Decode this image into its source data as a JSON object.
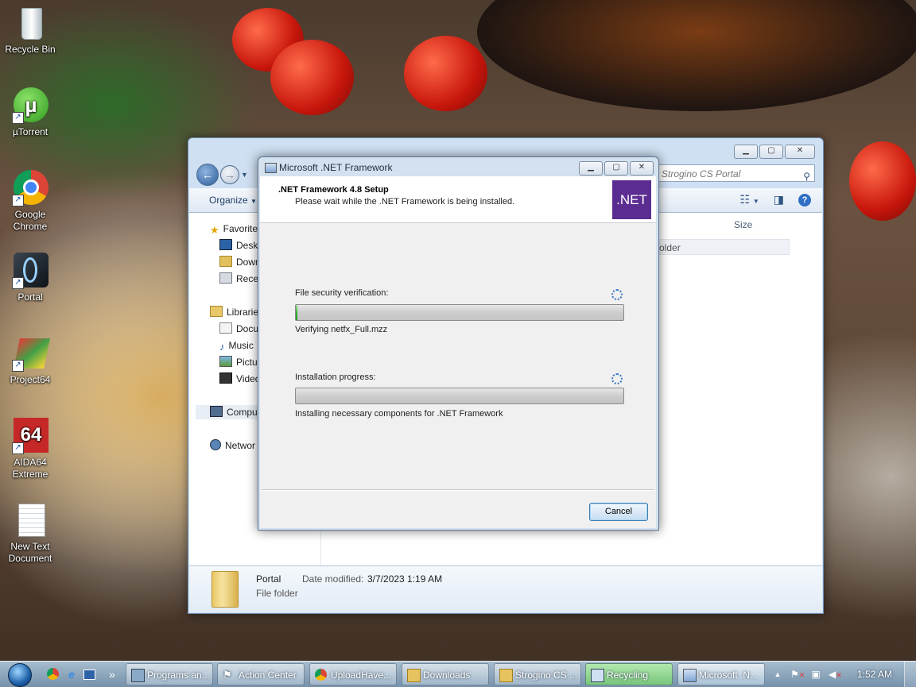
{
  "desktop": {
    "icons": [
      {
        "label": "Recycle Bin"
      },
      {
        "label": "µTorrent"
      },
      {
        "label": "Google Chrome"
      },
      {
        "label": "Portal"
      },
      {
        "label": "Project64"
      },
      {
        "label": "AIDA64 Extreme"
      },
      {
        "label": "New Text Document"
      }
    ]
  },
  "explorer": {
    "search_placeholder": "Strogino CS Portal",
    "organize_label": "Organize",
    "nav": [
      {
        "label": "Favorite"
      },
      {
        "label": "Deskt"
      },
      {
        "label": "Down"
      },
      {
        "label": "Recen"
      },
      {
        "label": "Librarie"
      },
      {
        "label": "Docu"
      },
      {
        "label": "Music"
      },
      {
        "label": "Pictur"
      },
      {
        "label": "Video"
      },
      {
        "label": "Compu"
      },
      {
        "label": "Networ"
      }
    ],
    "column_size": "Size",
    "folder_row_text": "older",
    "details": {
      "name": "Portal",
      "type": "File folder",
      "modified_label": "Date modified:",
      "modified_value": "3/7/2023 1:19 AM"
    }
  },
  "dialog": {
    "title": "Microsoft .NET Framework",
    "header_title": ".NET Framework 4.8 Setup",
    "header_subtitle": "Please wait while the .NET Framework is being installed.",
    "logo_text": ".NET",
    "verification_label": "File security verification:",
    "verification_progress": 0.005,
    "verification_status": "Verifying netfx_Full.mzz",
    "install_label": "Installation progress:",
    "install_progress": 0,
    "install_status": "Installing necessary components for .NET Framework",
    "cancel_label": "Cancel"
  },
  "taskbar": {
    "buttons": [
      {
        "label": "Programs an..."
      },
      {
        "label": "Action Center"
      },
      {
        "label": "UploadHave..."
      },
      {
        "label": "Downloads"
      },
      {
        "label": "Strogino CS ..."
      },
      {
        "label": "Recycling"
      },
      {
        "label": "Microsoft .N..."
      }
    ],
    "overflow_label": "»",
    "clock": "1:52 AM"
  }
}
